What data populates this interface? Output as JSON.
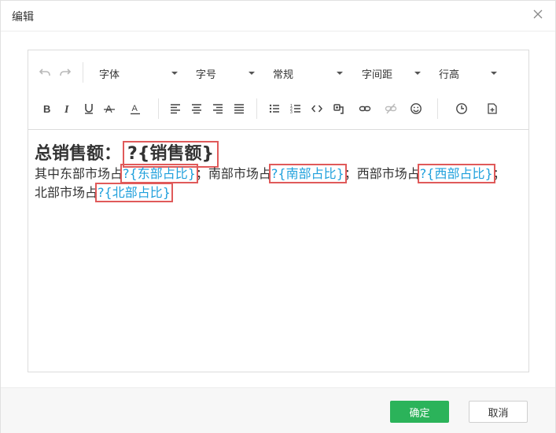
{
  "dialog": {
    "title": "编辑",
    "ok_label": "确定",
    "cancel_label": "取消"
  },
  "toolbar": {
    "font_family": "字体",
    "font_size": "字号",
    "paragraph_style": "常规",
    "letter_spacing": "字间距",
    "line_height": "行高"
  },
  "content": {
    "line1_label": "总销售额：",
    "line1_var": "?{销售额}",
    "east_label": "其中东部市场占",
    "east_var": "?{东部占比}",
    "sep1": "；",
    "south_label": "南部市场占",
    "south_var": "?{南部占比}",
    "sep2": "；",
    "west_label": "西部市场占",
    "west_var": "?{西部占比}",
    "sep3": "；",
    "north_label": "北部市场占",
    "north_var": "?{北部占比}"
  },
  "colors": {
    "accent": "#2bb35a",
    "variable": "#1fa0dc",
    "highlight": "#e05a5a"
  }
}
